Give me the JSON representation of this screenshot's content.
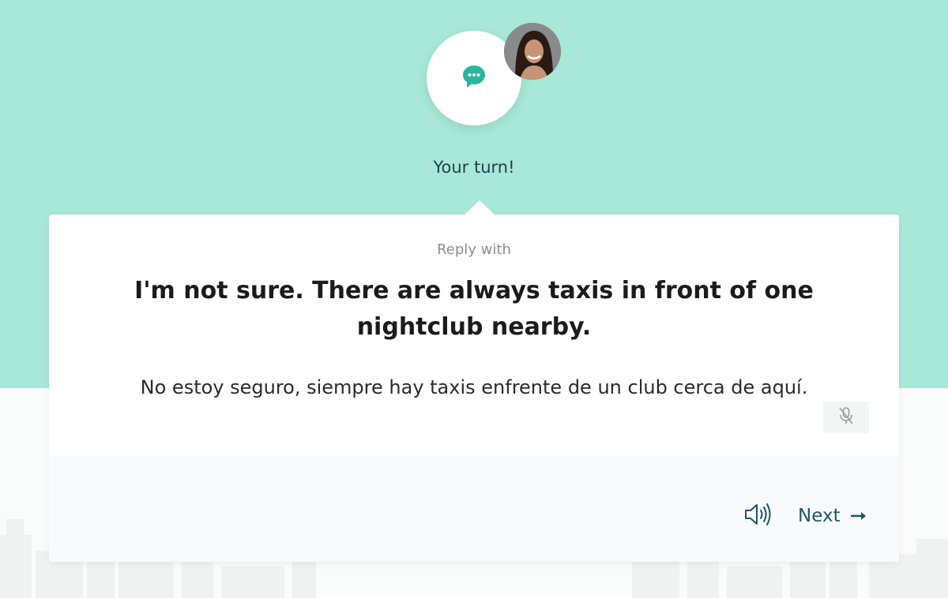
{
  "header": {
    "turn_label": "Your turn!",
    "bubble_icon": "chat-bubble-icon",
    "avatar": "speaker-avatar"
  },
  "card": {
    "reply_with_label": "Reply with",
    "reply_text": "I'm not sure. There are always taxis in front of one nightclub nearby.",
    "translation": "No estoy seguro, siempre hay taxis enfrente de un club cerca de aquí.",
    "mic_icon": "mic-off-icon"
  },
  "footer": {
    "speaker_icon": "speaker-icon",
    "next_label": "Next",
    "next_icon": "arrow-right-icon"
  },
  "colors": {
    "top_band": "#a7e8d8",
    "accent": "#2bb5a0",
    "footer_text": "#1f5566"
  }
}
